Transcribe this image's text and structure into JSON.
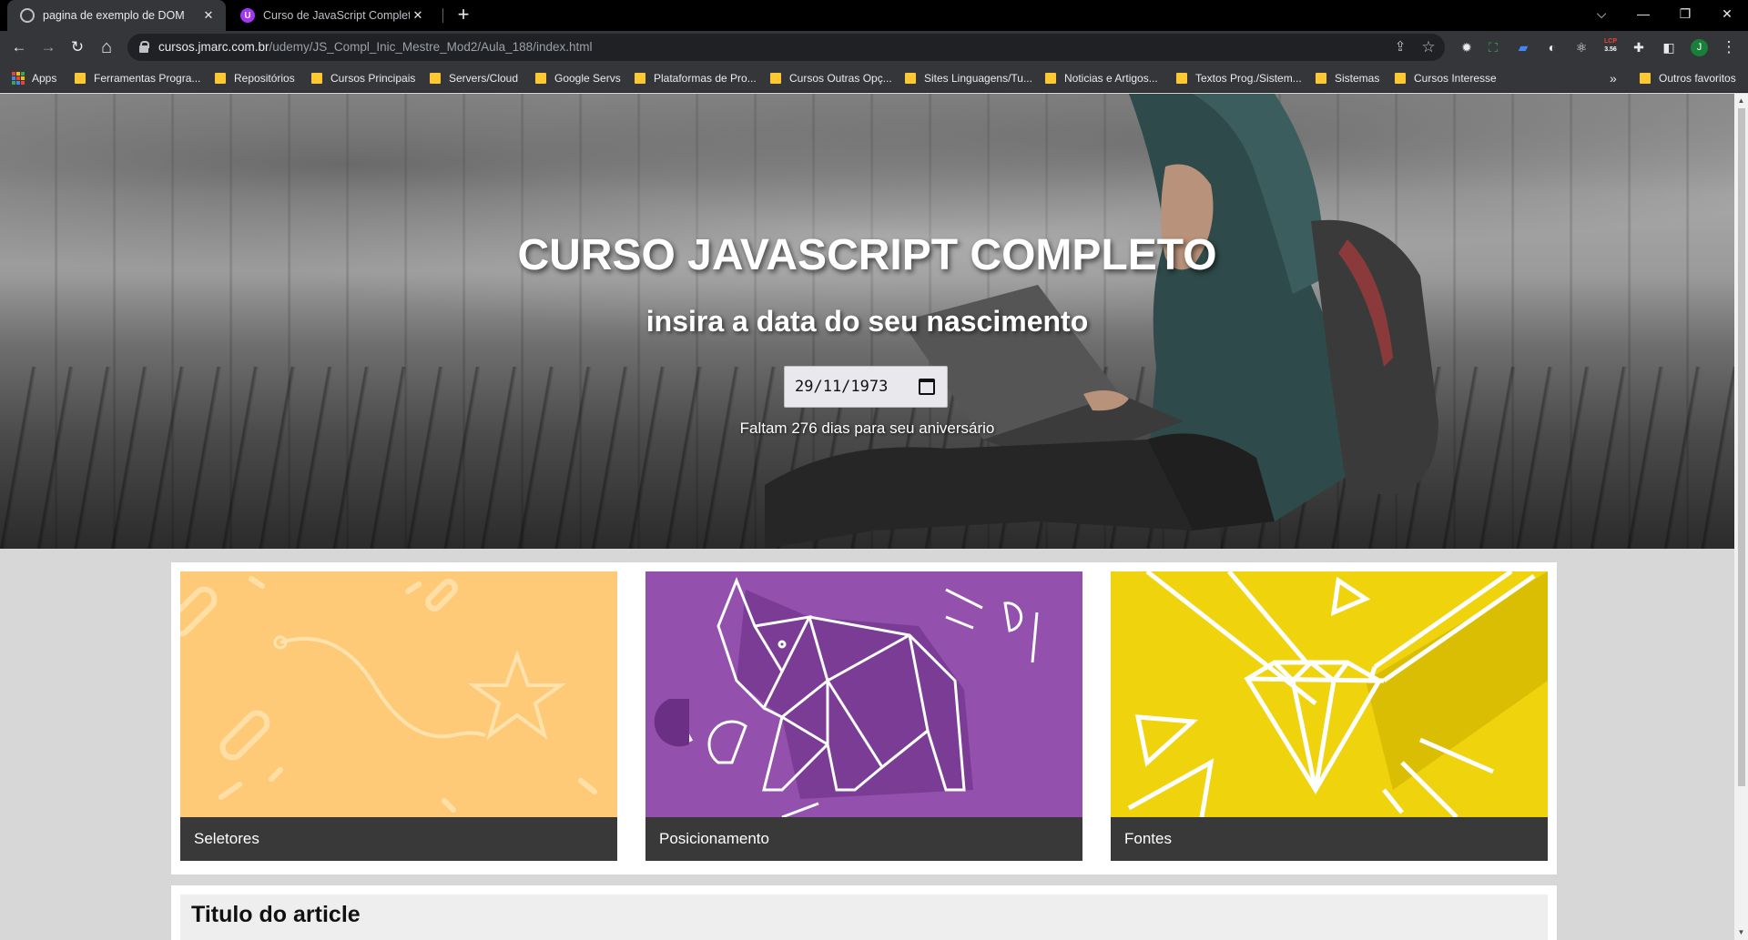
{
  "browser": {
    "tabs": [
      {
        "title": "pagina de exemplo de DOM",
        "active": true
      },
      {
        "title": "Curso de JavaScript Completo do",
        "active": false
      }
    ],
    "new_tab_symbol": "+",
    "window_controls": {
      "list": "⌵",
      "minimize": "—",
      "restore": "❐",
      "close": "✕"
    },
    "nav": {
      "back": "←",
      "forward": "→",
      "reload": "↻",
      "home": "⌂"
    },
    "url_host": "cursos.jmarc.com.br",
    "url_path": "/udemy/JS_Compl_Inic_Mestre_Mod2/Aula_188/index.html",
    "omnibox_icons": {
      "share": "⇪",
      "star": "☆"
    },
    "extensions": {
      "badge_top": "LCP",
      "badge_bottom": "3.56",
      "avatar_letter": "J",
      "menu": "⋮"
    },
    "bookmarks": [
      "Apps",
      "Ferramentas Progra...",
      "Repositórios",
      "Cursos Principais",
      "Servers/Cloud",
      "Google Servs",
      "Plataformas de Pro...",
      "Cursos Outras Opç...",
      "Sites Linguagens/Tu...",
      "Noticias e Artigos...",
      "Textos Prog./Sistem...",
      "Sistemas",
      "Cursos Interesse"
    ],
    "bookmarks_overflow": "»",
    "other_bookmarks": "Outros favoritos"
  },
  "page": {
    "hero": {
      "title": "CURSO JAVASCRIPT COMPLETO",
      "subtitle": "insira a data do seu nascimento",
      "date_value": "29/11/1973",
      "countdown": "Faltam 276 dias para seu aniversário"
    },
    "cards": [
      {
        "label": "Seletores",
        "color": "#ffca78"
      },
      {
        "label": "Posicionamento",
        "color": "#9350ad"
      },
      {
        "label": "Fontes",
        "color": "#efd30c"
      }
    ],
    "article": {
      "title": "Titulo do article"
    }
  },
  "colors": {
    "chrome_dark": "#000000",
    "toolbar": "#35363a",
    "card_label_bg": "#393939",
    "page_bg": "#d7d7d7"
  }
}
